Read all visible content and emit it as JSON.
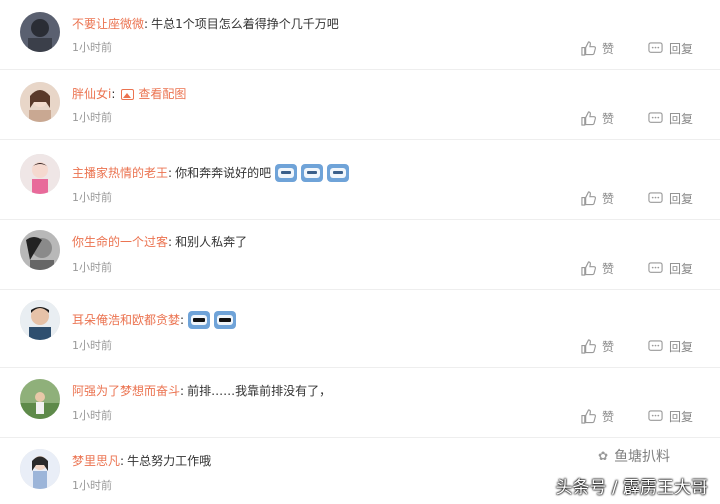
{
  "actions": {
    "like_label": "赞",
    "reply_label": "回复"
  },
  "view_image_label": "查看配图",
  "comments": [
    {
      "user": "不要让座微微",
      "colon": ":",
      "text": "牛总1个项目怎么着得挣个几千万吧",
      "time": "1小时前",
      "emoji_count": 0
    },
    {
      "user": "胖仙女i",
      "colon": ":",
      "text": "",
      "time": "1小时前",
      "has_image": true,
      "emoji_count": 0
    },
    {
      "user": "主播家热情的老王",
      "colon": ":",
      "text": "你和奔奔说好的吧",
      "time": "1小时前",
      "emoji_count": 3
    },
    {
      "user": "你生命的一个过客",
      "colon": ":",
      "text": "和别人私奔了",
      "time": "1小时前",
      "emoji_count": 0
    },
    {
      "user": "耳朵俺浩和欧都贪婪",
      "colon": ":",
      "text": "",
      "time": "1小时前",
      "emoji_count": 2
    },
    {
      "user": "阿强为了梦想而奋斗",
      "colon": ":",
      "text": "前排……我靠前排没有了，",
      "time": "1小时前",
      "emoji_count": 0
    },
    {
      "user": "梦里思凡",
      "colon": ":",
      "text": "牛总努力工作哦",
      "time": "1小时前",
      "emoji_count": 0
    }
  ],
  "watermark": {
    "logo_text": "鱼塘扒料",
    "caption": "头条号 / 霹雳王大哥"
  },
  "colors": {
    "username": "#eb7350",
    "time": "#999999",
    "text": "#333333"
  }
}
